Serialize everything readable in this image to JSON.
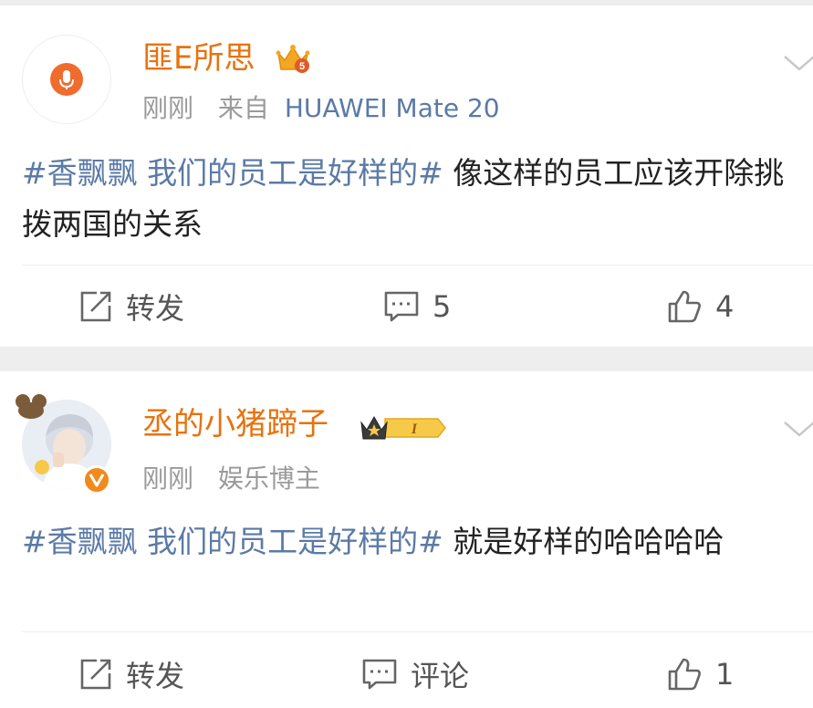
{
  "posts": [
    {
      "username": "匪E所思",
      "member_level": "5",
      "time": "刚刚",
      "source_prefix": "来自",
      "source_device": "HUAWEI Mate 20",
      "hashtag": "#香飘飘 我们的员工是好样的#",
      "text": " 像这样的员工应该开除挑拨两国的关系",
      "actions": {
        "repost_label": "转发",
        "comment_count": "5",
        "like_count": "4"
      }
    },
    {
      "username": "丞的小猪蹄子",
      "member_level": "I",
      "time": "刚刚",
      "user_tag": "娱乐博主",
      "hashtag": "#香飘飘 我们的员工是好样的#",
      "text": " 就是好样的哈哈哈哈",
      "actions": {
        "repost_label": "转发",
        "comment_label": "评论",
        "like_count": "1"
      }
    }
  ],
  "colors": {
    "username": "#e8720c",
    "link": "#5b7aa6",
    "meta": "#9a9a9a",
    "separator": "#eeeeee"
  }
}
